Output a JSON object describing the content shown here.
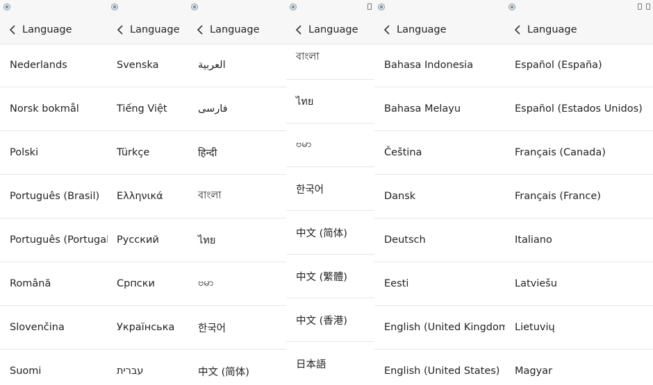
{
  "header_title": "Language",
  "panels": [
    {
      "languages": [
        "Nederlands",
        "Norsk bokmål",
        "Polski",
        "Português (Brasil)",
        "Português (Portugal)",
        "Română",
        "Slovenčina",
        "Suomi"
      ]
    },
    {
      "languages": [
        "Svenska",
        "Tiếng Việt",
        "Türkçe",
        "Ελληνικά",
        "Русский",
        "Српски",
        "Українська",
        "עברית"
      ]
    },
    {
      "languages": [
        "العربية",
        "فارسی",
        "हिन्दी",
        "বাংলা",
        "ไทย",
        "ဗမာ",
        "한국어",
        "中文 (简体)"
      ]
    },
    {
      "languages": [
        "বাংলা",
        "ไทย",
        "ဗမာ",
        "한국어",
        "中文 (简体)",
        "中文 (繁體)",
        "中文 (香港)",
        "日本語"
      ]
    },
    {
      "languages": [
        "Bahasa Indonesia",
        "Bahasa Melayu",
        "Čeština",
        "Dansk",
        "Deutsch",
        "Eesti",
        "English (United Kingdom)",
        "English (United States)"
      ]
    },
    {
      "languages": [
        "Español (España)",
        "Español (Estados Unidos)",
        "Français (Canada)",
        "Français (France)",
        "Italiano",
        "Latviešu",
        "Lietuvių",
        "Magyar"
      ]
    }
  ]
}
